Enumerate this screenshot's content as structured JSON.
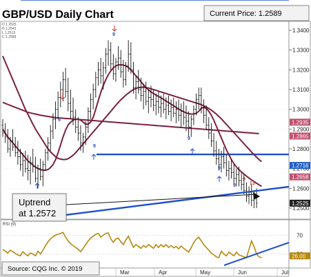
{
  "chart_data": {
    "type": "candlestick",
    "title": "GBP/USD Daily Chart",
    "price_box": "Current Price: 1.2589",
    "source": "Source: CQG Inc. © 2019",
    "callout": [
      "Uptrend",
      "at 1.2572"
    ],
    "rsi_label": "RSI (9)",
    "x_ticks": [
      "Mar",
      "Apr",
      "May",
      "Jun",
      "Jul"
    ],
    "y_ticks": [
      "1.3400",
      "1.3300",
      "1.3200",
      "1.3100",
      "1.3000",
      "1.2900",
      "1.2800",
      "1.2700",
      "1.2600",
      "1.2500"
    ],
    "price_tags": [
      {
        "label": "1.2935",
        "value": 1.2935,
        "color": "#c0506e"
      },
      {
        "label": "1.2865",
        "value": 1.2865,
        "color": "#c0506e"
      },
      {
        "label": "1.2716",
        "value": 1.2716,
        "color": "#1f5fc8"
      },
      {
        "label": "1.2658",
        "value": 1.2658,
        "color": "#c0506e"
      },
      {
        "label": "1.2525",
        "value": 1.2525,
        "color": "#222222"
      }
    ],
    "rsi_ticks": [
      "70",
      "30"
    ],
    "rsi_tag": "26.00",
    "horizontal_levels": [
      1.3555,
      1.2772
    ],
    "uptrend_line": [
      [
        1,
        1.2455
      ],
      [
        139,
        1.2595
      ]
    ],
    "support_line": [
      [
        3,
        1.2505
      ],
      [
        139,
        1.2572
      ]
    ],
    "ohlc": [
      [
        1.292,
        1.295,
        1.286,
        1.288
      ],
      [
        1.288,
        1.293,
        1.283,
        1.286
      ],
      [
        1.286,
        1.29,
        1.278,
        1.28
      ],
      [
        1.28,
        1.286,
        1.276,
        1.284
      ],
      [
        1.284,
        1.29,
        1.279,
        1.281
      ],
      [
        1.281,
        1.286,
        1.276,
        1.278
      ],
      [
        1.278,
        1.284,
        1.272,
        1.276
      ],
      [
        1.276,
        1.28,
        1.269,
        1.272
      ],
      [
        1.272,
        1.278,
        1.266,
        1.274
      ],
      [
        1.274,
        1.279,
        1.268,
        1.27
      ],
      [
        1.27,
        1.277,
        1.264,
        1.269
      ],
      [
        1.269,
        1.276,
        1.262,
        1.273
      ],
      [
        1.273,
        1.28,
        1.268,
        1.271
      ],
      [
        1.271,
        1.276,
        1.263,
        1.265
      ],
      [
        1.265,
        1.272,
        1.26,
        1.27
      ],
      [
        1.27,
        1.275,
        1.264,
        1.266
      ],
      [
        1.266,
        1.274,
        1.261,
        1.272
      ],
      [
        1.272,
        1.28,
        1.269,
        1.278
      ],
      [
        1.278,
        1.286,
        1.274,
        1.283
      ],
      [
        1.283,
        1.292,
        1.279,
        1.289
      ],
      [
        1.289,
        1.298,
        1.285,
        1.295
      ],
      [
        1.295,
        1.304,
        1.29,
        1.3
      ],
      [
        1.3,
        1.309,
        1.295,
        1.306
      ],
      [
        1.306,
        1.314,
        1.301,
        1.31
      ],
      [
        1.31,
        1.319,
        1.304,
        1.315
      ],
      [
        1.315,
        1.321,
        1.306,
        1.309
      ],
      [
        1.309,
        1.316,
        1.299,
        1.303
      ],
      [
        1.303,
        1.31,
        1.295,
        1.299
      ],
      [
        1.299,
        1.306,
        1.292,
        1.296
      ],
      [
        1.296,
        1.3,
        1.288,
        1.291
      ],
      [
        1.291,
        1.296,
        1.284,
        1.288
      ],
      [
        1.288,
        1.292,
        1.279,
        1.283
      ],
      [
        1.283,
        1.288,
        1.278,
        1.286
      ],
      [
        1.286,
        1.294,
        1.282,
        1.291
      ],
      [
        1.291,
        1.301,
        1.288,
        1.299
      ],
      [
        1.299,
        1.308,
        1.295,
        1.305
      ],
      [
        1.305,
        1.313,
        1.3,
        1.31
      ],
      [
        1.31,
        1.319,
        1.306,
        1.316
      ],
      [
        1.316,
        1.324,
        1.312,
        1.32
      ],
      [
        1.32,
        1.326,
        1.313,
        1.317
      ],
      [
        1.317,
        1.324,
        1.31,
        1.321
      ],
      [
        1.321,
        1.331,
        1.318,
        1.328
      ],
      [
        1.328,
        1.335,
        1.322,
        1.33
      ],
      [
        1.33,
        1.334,
        1.32,
        1.323
      ],
      [
        1.323,
        1.328,
        1.315,
        1.318
      ],
      [
        1.318,
        1.326,
        1.314,
        1.324
      ],
      [
        1.324,
        1.332,
        1.32,
        1.326
      ],
      [
        1.326,
        1.33,
        1.316,
        1.319
      ],
      [
        1.319,
        1.325,
        1.311,
        1.315
      ],
      [
        1.315,
        1.324,
        1.312,
        1.322
      ],
      [
        1.322,
        1.335,
        1.319,
        1.328
      ],
      [
        1.328,
        1.334,
        1.318,
        1.32
      ],
      [
        1.32,
        1.324,
        1.308,
        1.311
      ],
      [
        1.311,
        1.317,
        1.305,
        1.314
      ],
      [
        1.314,
        1.32,
        1.308,
        1.31
      ],
      [
        1.31,
        1.316,
        1.304,
        1.307
      ],
      [
        1.307,
        1.313,
        1.3,
        1.309
      ],
      [
        1.309,
        1.314,
        1.302,
        1.304
      ],
      [
        1.304,
        1.31,
        1.298,
        1.306
      ],
      [
        1.306,
        1.312,
        1.301,
        1.305
      ],
      [
        1.305,
        1.31,
        1.299,
        1.302
      ],
      [
        1.302,
        1.308,
        1.297,
        1.304
      ],
      [
        1.304,
        1.309,
        1.298,
        1.301
      ],
      [
        1.301,
        1.307,
        1.296,
        1.303
      ],
      [
        1.303,
        1.308,
        1.298,
        1.3
      ],
      [
        1.3,
        1.306,
        1.295,
        1.302
      ],
      [
        1.302,
        1.307,
        1.297,
        1.299
      ],
      [
        1.299,
        1.305,
        1.294,
        1.301
      ],
      [
        1.301,
        1.306,
        1.296,
        1.298
      ],
      [
        1.298,
        1.304,
        1.293,
        1.3
      ],
      [
        1.3,
        1.305,
        1.294,
        1.297
      ],
      [
        1.297,
        1.303,
        1.291,
        1.299
      ],
      [
        1.299,
        1.304,
        1.292,
        1.296
      ],
      [
        1.296,
        1.302,
        1.289,
        1.294
      ],
      [
        1.294,
        1.299,
        1.286,
        1.291
      ],
      [
        1.291,
        1.297,
        1.286,
        1.295
      ],
      [
        1.295,
        1.302,
        1.292,
        1.3
      ],
      [
        1.3,
        1.308,
        1.297,
        1.305
      ],
      [
        1.305,
        1.311,
        1.3,
        1.307
      ],
      [
        1.307,
        1.311,
        1.298,
        1.301
      ],
      [
        1.301,
        1.305,
        1.293,
        1.297
      ],
      [
        1.297,
        1.302,
        1.29,
        1.292
      ],
      [
        1.292,
        1.296,
        1.285,
        1.288
      ],
      [
        1.288,
        1.293,
        1.281,
        1.284
      ],
      [
        1.284,
        1.288,
        1.276,
        1.279
      ],
      [
        1.279,
        1.284,
        1.272,
        1.275
      ],
      [
        1.275,
        1.28,
        1.269,
        1.272
      ],
      [
        1.272,
        1.279,
        1.268,
        1.276
      ],
      [
        1.276,
        1.281,
        1.27,
        1.273
      ],
      [
        1.273,
        1.277,
        1.266,
        1.269
      ],
      [
        1.269,
        1.274,
        1.264,
        1.27
      ],
      [
        1.27,
        1.275,
        1.265,
        1.268
      ],
      [
        1.268,
        1.272,
        1.262,
        1.265
      ],
      [
        1.265,
        1.27,
        1.261,
        1.267
      ],
      [
        1.267,
        1.271,
        1.261,
        1.264
      ],
      [
        1.264,
        1.268,
        1.259,
        1.262
      ],
      [
        1.262,
        1.267,
        1.257,
        1.259
      ],
      [
        1.259,
        1.263,
        1.253,
        1.256
      ],
      [
        1.256,
        1.261,
        1.252,
        1.258
      ],
      [
        1.258,
        1.262,
        1.251,
        1.254
      ],
      [
        1.254,
        1.259,
        1.25,
        1.257
      ],
      [
        1.257,
        1.26,
        1.25,
        1.2525
      ]
    ],
    "sma_long": [
      1.3035,
      1.303,
      1.3025,
      1.302,
      1.3015,
      1.301,
      1.3005,
      1.3,
      1.2995,
      1.299,
      1.2985,
      1.2982,
      1.2979,
      1.2976,
      1.2973,
      1.297,
      1.2968,
      1.2966,
      1.2964,
      1.2962,
      1.296,
      1.2958,
      1.2957,
      1.2956,
      1.2955,
      1.2954,
      1.2953,
      1.2952,
      1.2951,
      1.295,
      1.2949,
      1.2948,
      1.2947,
      1.2946,
      1.2945,
      1.2944,
      1.2943,
      1.2942,
      1.2941,
      1.294,
      1.2939,
      1.2938,
      1.2937,
      1.2936,
      1.2935,
      1.2934,
      1.2933,
      1.2932,
      1.2931,
      1.293,
      1.2929,
      1.2928,
      1.2927,
      1.2926,
      1.2925,
      1.2924,
      1.2923,
      1.2922,
      1.2921,
      1.292,
      1.2919,
      1.2918,
      1.2917,
      1.2916,
      1.2915,
      1.2914,
      1.2913,
      1.2912,
      1.2911,
      1.291,
      1.2909,
      1.2908,
      1.2907,
      1.2906,
      1.2905,
      1.2904,
      1.2903,
      1.2902,
      1.2901,
      1.29,
      1.2899,
      1.2898,
      1.2897,
      1.2896,
      1.2895,
      1.2894,
      1.2893,
      1.2892,
      1.2891,
      1.289,
      1.2889,
      1.2888,
      1.2887,
      1.2886,
      1.2885,
      1.2884,
      1.2883,
      1.2882,
      1.2881,
      1.288,
      1.2879,
      1.2878,
      1.2877
    ],
    "sma_mid": [
      1.327,
      1.324,
      1.321,
      1.318,
      1.315,
      1.312,
      1.309,
      1.306,
      1.303,
      1.3,
      1.2975,
      1.295,
      1.2925,
      1.29,
      1.288,
      1.286,
      1.284,
      1.282,
      1.28,
      1.2785,
      1.2772,
      1.276,
      1.2752,
      1.2748,
      1.2746,
      1.2746,
      1.275,
      1.2758,
      1.2768,
      1.278,
      1.2795,
      1.281,
      1.2825,
      1.284,
      1.2855,
      1.287,
      1.2885,
      1.29,
      1.2915,
      1.293,
      1.2945,
      1.296,
      1.2975,
      1.299,
      1.3005,
      1.302,
      1.3035,
      1.3048,
      1.306,
      1.3072,
      1.3082,
      1.3092,
      1.31,
      1.3106,
      1.311,
      1.3112,
      1.3112,
      1.311,
      1.3108,
      1.3104,
      1.31,
      1.3096,
      1.3092,
      1.3088,
      1.3084,
      1.308,
      1.3076,
      1.3072,
      1.3068,
      1.3064,
      1.306,
      1.3056,
      1.3052,
      1.3048,
      1.3044,
      1.304,
      1.3036,
      1.3032,
      1.3028,
      1.3024,
      1.3018,
      1.3012,
      1.3004,
      1.2996,
      1.2986,
      1.2976,
      1.2964,
      1.2952,
      1.2938,
      1.2924,
      1.291,
      1.2896,
      1.2882,
      1.2868,
      1.2854,
      1.284,
      1.2826,
      1.2812,
      1.2798,
      1.2784,
      1.277,
      1.2758,
      1.2746,
      1.2735
    ],
    "sma_short": [
      1.29,
      1.288,
      1.286,
      1.2845,
      1.283,
      1.2815,
      1.28,
      1.2785,
      1.277,
      1.2755,
      1.274,
      1.2728,
      1.2718,
      1.2708,
      1.27,
      1.2695,
      1.2692,
      1.2692,
      1.2695,
      1.2705,
      1.272,
      1.2745,
      1.278,
      1.282,
      1.286,
      1.2895,
      1.292,
      1.2935,
      1.2945,
      1.295,
      1.295,
      1.2945,
      1.2935,
      1.2925,
      1.2925,
      1.2935,
      1.296,
      1.3,
      1.3045,
      1.3085,
      1.312,
      1.315,
      1.3175,
      1.3195,
      1.321,
      1.322,
      1.3225,
      1.3226,
      1.3224,
      1.322,
      1.3212,
      1.32,
      1.3185,
      1.317,
      1.3155,
      1.314,
      1.3125,
      1.311,
      1.3098,
      1.3088,
      1.308,
      1.3072,
      1.3065,
      1.3058,
      1.305,
      1.3042,
      1.3034,
      1.3026,
      1.3018,
      1.301,
      1.3002,
      1.2994,
      1.2988,
      1.2982,
      1.2978,
      1.2976,
      1.2976,
      1.298,
      1.299,
      1.3005,
      1.301,
      1.3005,
      1.299,
      1.297,
      1.2945,
      1.2915,
      1.2885,
      1.2855,
      1.2825,
      1.2795,
      1.277,
      1.2745,
      1.2725,
      1.2708,
      1.2695,
      1.2683,
      1.2672,
      1.2662,
      1.2652,
      1.2643,
      1.2635,
      1.2626,
      1.2618,
      1.261
    ],
    "rsi": [
      40,
      36,
      32,
      38,
      35,
      31,
      28,
      26,
      35,
      30,
      26,
      32,
      30,
      26,
      36,
      30,
      38,
      48,
      56,
      62,
      67,
      70,
      72,
      74,
      76,
      66,
      58,
      52,
      48,
      44,
      40,
      35,
      42,
      50,
      58,
      64,
      68,
      72,
      74,
      66,
      70,
      74,
      75,
      62,
      55,
      62,
      64,
      56,
      50,
      60,
      68,
      56,
      44,
      50,
      46,
      42,
      48,
      44,
      50,
      46,
      42,
      50,
      44,
      50,
      45,
      50,
      44,
      48,
      43,
      46,
      41,
      47,
      42,
      38,
      34,
      44,
      54,
      62,
      66,
      58,
      50,
      44,
      38,
      32,
      28,
      24,
      22,
      36,
      30,
      26,
      34,
      30,
      26,
      34,
      28,
      26,
      24,
      22,
      40,
      58,
      46,
      30,
      24,
      22
    ]
  },
  "indicators": {
    "td_counts_top": [
      "9"
    ],
    "td_counts_mid": [
      "9",
      "9",
      "9",
      "9",
      "9",
      "9",
      "13"
    ]
  }
}
